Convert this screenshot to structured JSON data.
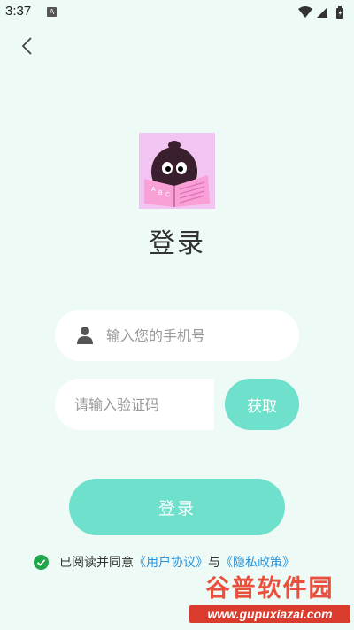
{
  "status_bar": {
    "time": "3:37",
    "notification": "A"
  },
  "page": {
    "title": "登录"
  },
  "form": {
    "phone_placeholder": "输入您的手机号",
    "phone_value": "",
    "code_placeholder": "请输入验证码",
    "code_value": "",
    "get_code_label": "获取",
    "login_label": "登录"
  },
  "agreement": {
    "checked": true,
    "prefix": "已阅读并同意",
    "user_agreement": "《用户协议》",
    "joiner": "与",
    "privacy_policy": "《隐私政策》"
  },
  "watermark": {
    "top": "谷普软件园",
    "bottom": "www.gupuxiazai.com"
  },
  "colors": {
    "background": "#eefaf6",
    "accent": "#6ee0cb",
    "link": "#2a92d8",
    "check": "#1fa64a"
  },
  "icons": [
    "back-arrow-icon",
    "user-icon",
    "check-circle-icon",
    "wifi-icon",
    "signal-icon",
    "battery-icon"
  ]
}
